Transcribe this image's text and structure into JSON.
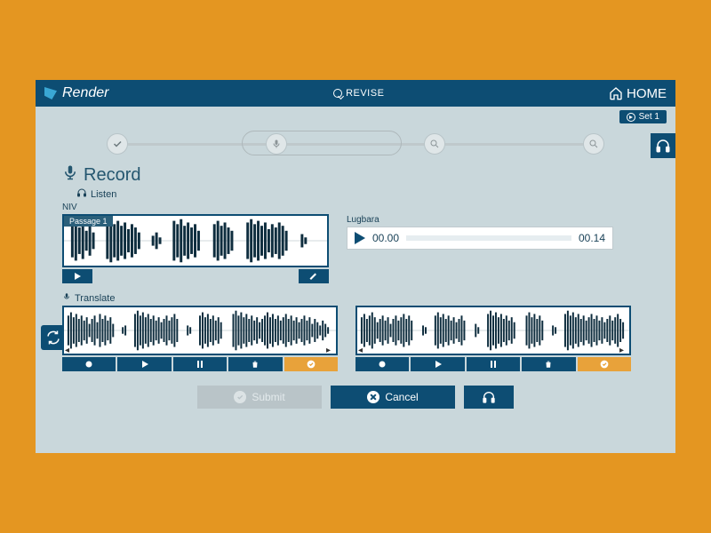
{
  "header": {
    "brand": "Render",
    "revise": "REVISE",
    "home": "HOME",
    "set_label": "Set 1"
  },
  "section": {
    "record": "Record",
    "listen": "Listen",
    "niv_label": "NIV",
    "passage": "Passage 1",
    "lugbara_label": "Lugbara",
    "time_start": "00.00",
    "time_end": "00.14",
    "translate": "Translate"
  },
  "footer": {
    "submit": "Submit",
    "cancel": "Cancel"
  },
  "colors": {
    "primary": "#0d4d73",
    "accent": "#e8a23a",
    "bg": "#c9d7db"
  }
}
